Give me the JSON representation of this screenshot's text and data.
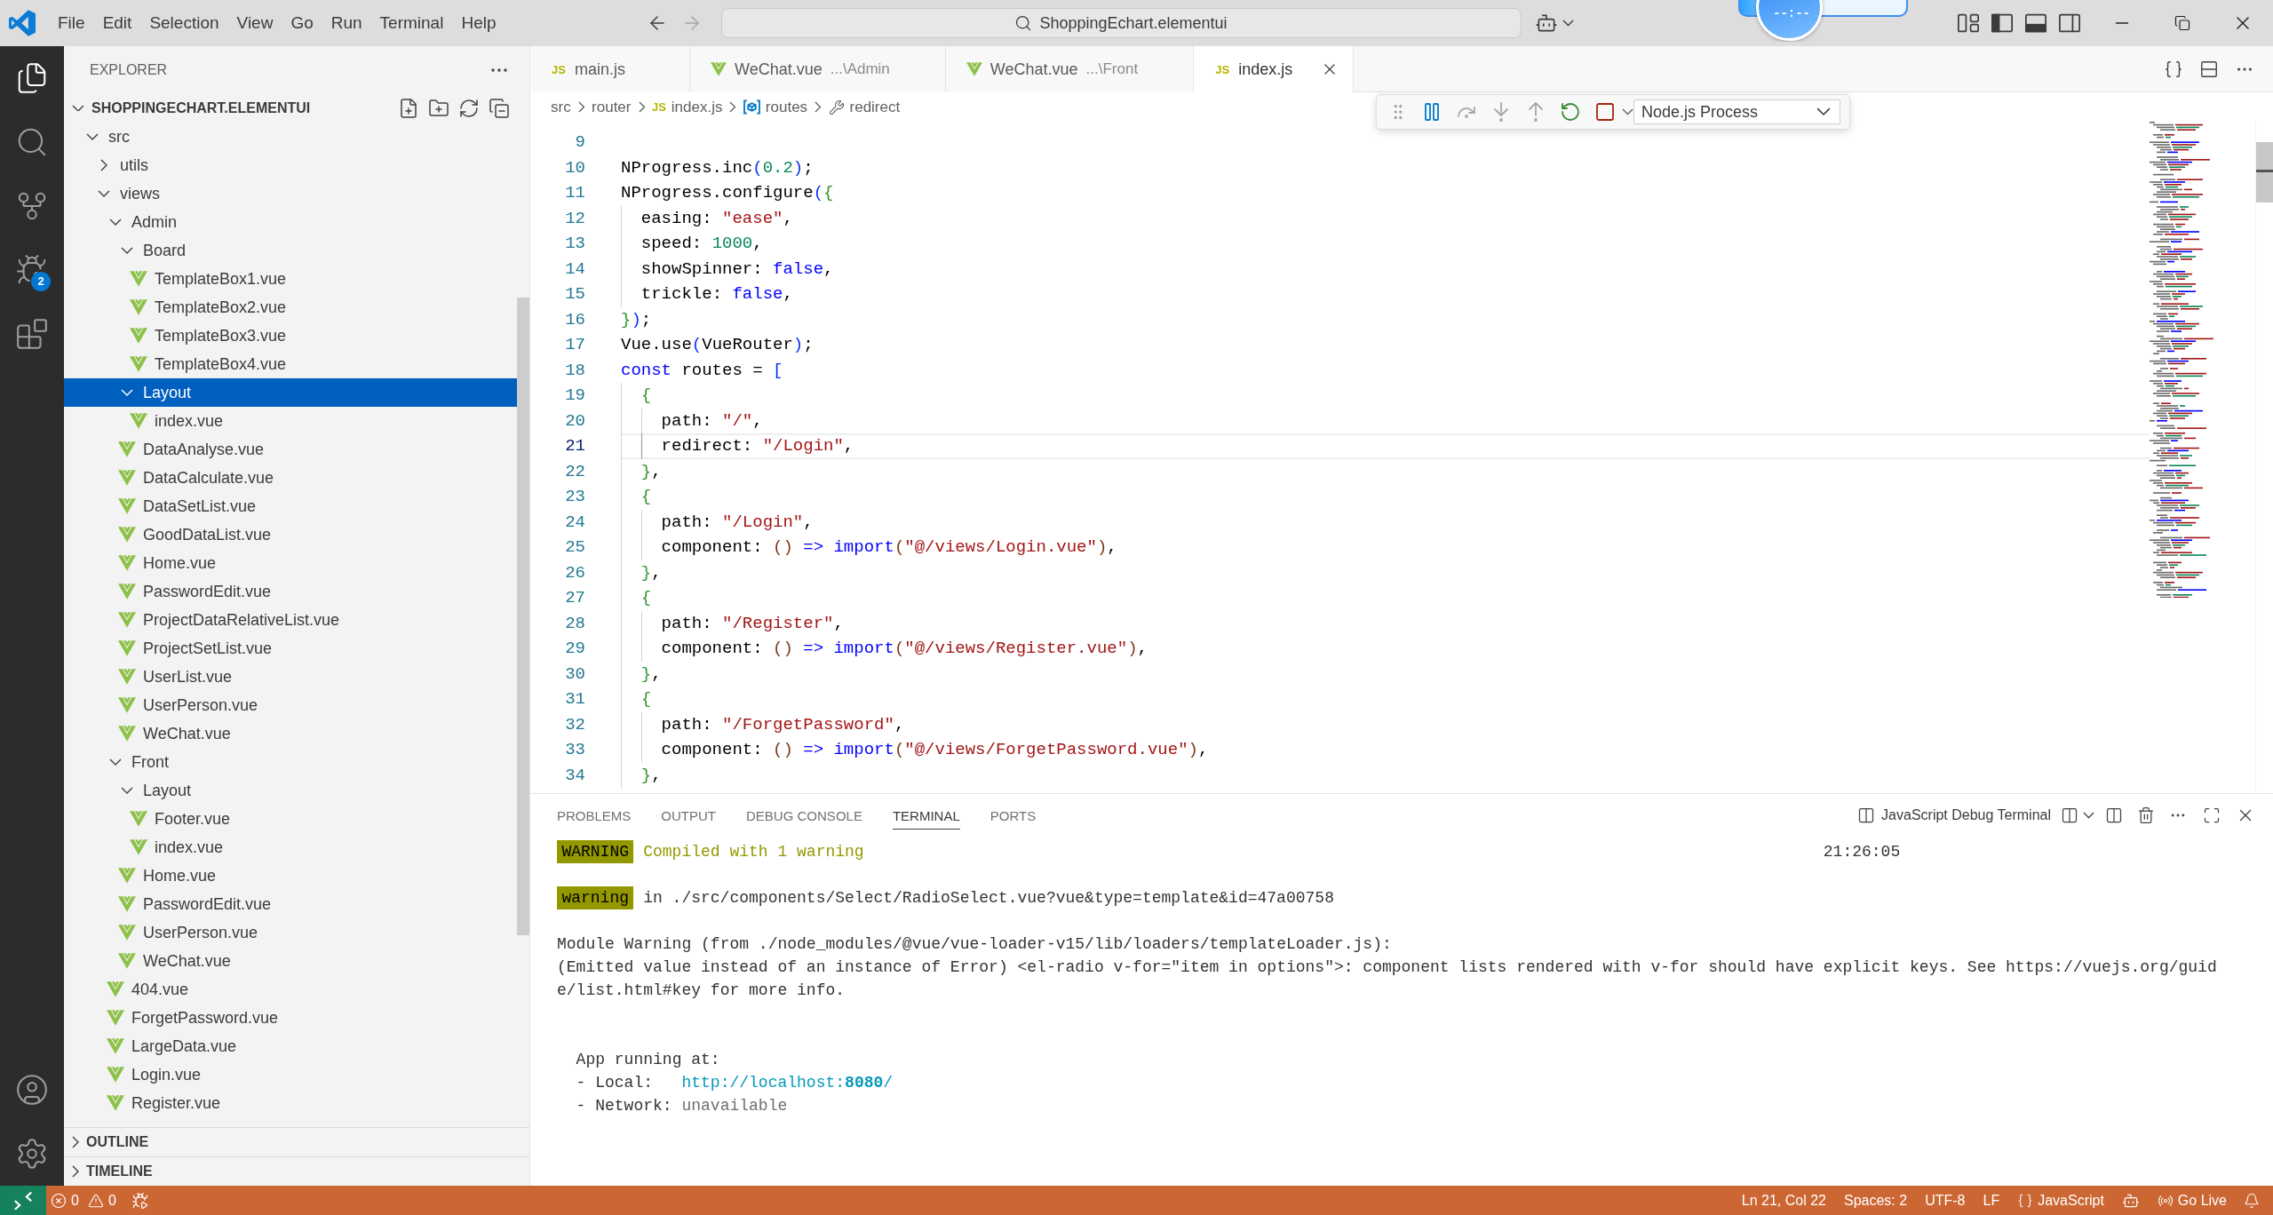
{
  "title_bar": {
    "menus": [
      "File",
      "Edit",
      "Selection",
      "View",
      "Go",
      "Run",
      "Terminal",
      "Help"
    ],
    "search": {
      "value": "ShoppingEchart.elementui"
    },
    "timer": {
      "text": "--:--"
    },
    "layout_toggles": [
      {
        "kind": "customize"
      },
      {
        "kind": "primary-sidebar",
        "on": true
      },
      {
        "kind": "panel",
        "on": true
      },
      {
        "kind": "secondary-sidebar",
        "on": false
      }
    ]
  },
  "activity_bar": {
    "items": [
      {
        "kind": "explorer",
        "selected": true
      },
      {
        "kind": "search",
        "selected": false
      },
      {
        "kind": "source-control",
        "selected": false
      },
      {
        "kind": "run-debug",
        "selected": false,
        "badge": "2"
      },
      {
        "kind": "extensions",
        "selected": false
      }
    ],
    "bottom": [
      {
        "kind": "accounts"
      },
      {
        "kind": "settings"
      }
    ]
  },
  "explorer": {
    "title": "EXPLORER",
    "project": {
      "name": "SHOPPINGECHART.ELEMENTUI",
      "expanded": true
    },
    "tree": [
      {
        "name": "src",
        "kind": "folder",
        "expanded": true,
        "selected": false,
        "children": [
          {
            "name": "utils",
            "kind": "folder",
            "expanded": false,
            "selected": false
          },
          {
            "name": "views",
            "kind": "folder",
            "expanded": true,
            "selected": false,
            "children": [
              {
                "name": "Admin",
                "kind": "folder",
                "expanded": true,
                "selected": false,
                "children": [
                  {
                    "name": "Board",
                    "kind": "folder",
                    "expanded": true,
                    "selected": false,
                    "children": [
                      {
                        "name": "TemplateBox1.vue",
                        "kind": "file",
                        "selected": false
                      },
                      {
                        "name": "TemplateBox2.vue",
                        "kind": "file",
                        "selected": false
                      },
                      {
                        "name": "TemplateBox3.vue",
                        "kind": "file",
                        "selected": false
                      },
                      {
                        "name": "TemplateBox4.vue",
                        "kind": "file",
                        "selected": false
                      }
                    ]
                  },
                  {
                    "name": "Layout",
                    "kind": "folder",
                    "expanded": true,
                    "selected": true,
                    "children": [
                      {
                        "name": "index.vue",
                        "kind": "file",
                        "selected": false
                      }
                    ]
                  },
                  {
                    "name": "DataAnalyse.vue",
                    "kind": "file",
                    "selected": false
                  },
                  {
                    "name": "DataCalculate.vue",
                    "kind": "file",
                    "selected": false
                  },
                  {
                    "name": "DataSetList.vue",
                    "kind": "file",
                    "selected": false
                  },
                  {
                    "name": "GoodDataList.vue",
                    "kind": "file",
                    "selected": false
                  },
                  {
                    "name": "Home.vue",
                    "kind": "file",
                    "selected": false
                  },
                  {
                    "name": "PasswordEdit.vue",
                    "kind": "file",
                    "selected": false
                  },
                  {
                    "name": "ProjectDataRelativeList.vue",
                    "kind": "file",
                    "selected": false
                  },
                  {
                    "name": "ProjectSetList.vue",
                    "kind": "file",
                    "selected": false
                  },
                  {
                    "name": "UserList.vue",
                    "kind": "file",
                    "selected": false
                  },
                  {
                    "name": "UserPerson.vue",
                    "kind": "file",
                    "selected": false
                  },
                  {
                    "name": "WeChat.vue",
                    "kind": "file",
                    "selected": false
                  }
                ]
              },
              {
                "name": "Front",
                "kind": "folder",
                "expanded": true,
                "selected": false,
                "children": [
                  {
                    "name": "Layout",
                    "kind": "folder",
                    "expanded": true,
                    "selected": false,
                    "children": [
                      {
                        "name": "Footer.vue",
                        "kind": "file",
                        "selected": false
                      },
                      {
                        "name": "index.vue",
                        "kind": "file",
                        "selected": false
                      }
                    ]
                  },
                  {
                    "name": "Home.vue",
                    "kind": "file",
                    "selected": false
                  },
                  {
                    "name": "PasswordEdit.vue",
                    "kind": "file",
                    "selected": false
                  },
                  {
                    "name": "UserPerson.vue",
                    "kind": "file",
                    "selected": false
                  },
                  {
                    "name": "WeChat.vue",
                    "kind": "file",
                    "selected": false
                  }
                ]
              },
              {
                "name": "404.vue",
                "kind": "file",
                "selected": false
              },
              {
                "name": "ForgetPassword.vue",
                "kind": "file",
                "selected": false
              },
              {
                "name": "LargeData.vue",
                "kind": "file",
                "selected": false
              },
              {
                "name": "Login.vue",
                "kind": "file",
                "selected": false
              },
              {
                "name": "Register.vue",
                "kind": "file",
                "selected": false
              }
            ]
          }
        ]
      }
    ],
    "sections": [
      {
        "title": "OUTLINE",
        "expanded": false
      },
      {
        "title": "TIMELINE",
        "expanded": false
      }
    ]
  },
  "tabs": [
    {
      "label": "main.js",
      "kind": "js",
      "icon_label": "JS",
      "selected": false
    },
    {
      "label": "WeChat.vue",
      "description": "...\\Admin",
      "kind": "vue",
      "selected": false
    },
    {
      "label": "WeChat.vue",
      "description": "...\\Front",
      "kind": "vue",
      "selected": false
    },
    {
      "label": "index.js",
      "kind": "js",
      "icon_label": "JS",
      "selected": true
    }
  ],
  "breadcrumb": [
    {
      "label": "src",
      "kind": "folder"
    },
    {
      "label": "router",
      "kind": "folder"
    },
    {
      "label": "index.js",
      "kind": "js",
      "icon_label": "JS"
    },
    {
      "label": "routes",
      "kind": "variable"
    },
    {
      "label": "redirect",
      "kind": "property"
    }
  ],
  "debug_toolbar": {
    "buttons": [
      {
        "kind": "pause",
        "disabled": false
      },
      {
        "kind": "step-over",
        "disabled": true
      },
      {
        "kind": "step-into",
        "disabled": true
      },
      {
        "kind": "step-out",
        "disabled": true
      },
      {
        "kind": "restart",
        "disabled": false
      },
      {
        "kind": "stop",
        "disabled": false
      }
    ],
    "target": {
      "value": "Node.js Process"
    }
  },
  "editor": {
    "lines": [
      {
        "number": "9",
        "current": false
      },
      {
        "number": "10",
        "current": false,
        "tokens": [
          {
            "kind": "plain",
            "text": "NProgress.inc"
          },
          {
            "kind": "bracket1",
            "text": "("
          },
          {
            "kind": "number",
            "text": "0.2"
          },
          {
            "kind": "bracket1",
            "text": ")"
          },
          {
            "kind": "plain",
            "text": ";"
          }
        ]
      },
      {
        "number": "11",
        "current": false,
        "tokens": [
          {
            "kind": "plain",
            "text": "NProgress.configure"
          },
          {
            "kind": "bracket1",
            "text": "("
          },
          {
            "kind": "bracket2",
            "text": "{"
          }
        ]
      },
      {
        "number": "12",
        "current": false,
        "tokens": [
          {
            "kind": "plain",
            "text": "  easing: "
          },
          {
            "kind": "string",
            "text": "\"ease\""
          },
          {
            "kind": "plain",
            "text": ","
          }
        ]
      },
      {
        "number": "13",
        "current": false,
        "tokens": [
          {
            "kind": "plain",
            "text": "  speed: "
          },
          {
            "kind": "number",
            "text": "1000"
          },
          {
            "kind": "plain",
            "text": ","
          }
        ]
      },
      {
        "number": "14",
        "current": false,
        "tokens": [
          {
            "kind": "plain",
            "text": "  showSpinner: "
          },
          {
            "kind": "keyword",
            "text": "false"
          },
          {
            "kind": "plain",
            "text": ","
          }
        ]
      },
      {
        "number": "15",
        "current": false,
        "tokens": [
          {
            "kind": "plain",
            "text": "  trickle: "
          },
          {
            "kind": "keyword",
            "text": "false"
          },
          {
            "kind": "plain",
            "text": ","
          }
        ]
      },
      {
        "number": "16",
        "current": false,
        "tokens": [
          {
            "kind": "bracket2",
            "text": "}"
          },
          {
            "kind": "bracket1",
            "text": ")"
          },
          {
            "kind": "plain",
            "text": ";"
          }
        ]
      },
      {
        "number": "17",
        "current": false,
        "tokens": [
          {
            "kind": "plain",
            "text": "Vue.use"
          },
          {
            "kind": "bracket1",
            "text": "("
          },
          {
            "kind": "plain",
            "text": "VueRouter"
          },
          {
            "kind": "bracket1",
            "text": ")"
          },
          {
            "kind": "plain",
            "text": ";"
          }
        ]
      },
      {
        "number": "18",
        "current": false,
        "tokens": [
          {
            "kind": "keyword",
            "text": "const"
          },
          {
            "kind": "plain",
            "text": " routes = "
          },
          {
            "kind": "bracket1",
            "text": "["
          }
        ]
      },
      {
        "number": "19",
        "current": false,
        "tokens": [
          {
            "kind": "bracket2",
            "text": "  {"
          }
        ]
      },
      {
        "number": "20",
        "current": false,
        "tokens": [
          {
            "kind": "plain",
            "text": "    path: "
          },
          {
            "kind": "string",
            "text": "\"/\""
          },
          {
            "kind": "plain",
            "text": ","
          }
        ]
      },
      {
        "number": "21",
        "current": true,
        "tokens": [
          {
            "kind": "plain",
            "text": "    redirect: "
          },
          {
            "kind": "string",
            "text": "\"/Login\""
          },
          {
            "kind": "plain",
            "text": ","
          }
        ]
      },
      {
        "number": "22",
        "current": false,
        "tokens": [
          {
            "kind": "bracket2",
            "text": "  }"
          },
          {
            "kind": "plain",
            "text": ","
          }
        ]
      },
      {
        "number": "23",
        "current": false,
        "tokens": [
          {
            "kind": "bracket2",
            "text": "  {"
          }
        ]
      },
      {
        "number": "24",
        "current": false,
        "tokens": [
          {
            "kind": "plain",
            "text": "    path: "
          },
          {
            "kind": "string",
            "text": "\"/Login\""
          },
          {
            "kind": "plain",
            "text": ","
          }
        ]
      },
      {
        "number": "25",
        "current": false,
        "tokens": [
          {
            "kind": "plain",
            "text": "    component: "
          },
          {
            "kind": "bracket3",
            "text": "()"
          },
          {
            "kind": "keyword",
            "text": " => import"
          },
          {
            "kind": "bracket3",
            "text": "("
          },
          {
            "kind": "string",
            "text": "\"@/views/Login.vue\""
          },
          {
            "kind": "bracket3",
            "text": ")"
          },
          {
            "kind": "plain",
            "text": ","
          }
        ]
      },
      {
        "number": "26",
        "current": false,
        "tokens": [
          {
            "kind": "bracket2",
            "text": "  }"
          },
          {
            "kind": "plain",
            "text": ","
          }
        ]
      },
      {
        "number": "27",
        "current": false,
        "tokens": [
          {
            "kind": "bracket2",
            "text": "  {"
          }
        ]
      },
      {
        "number": "28",
        "current": false,
        "tokens": [
          {
            "kind": "plain",
            "text": "    path: "
          },
          {
            "kind": "string",
            "text": "\"/Register\""
          },
          {
            "kind": "plain",
            "text": ","
          }
        ]
      },
      {
        "number": "29",
        "current": false,
        "tokens": [
          {
            "kind": "plain",
            "text": "    component: "
          },
          {
            "kind": "bracket3",
            "text": "()"
          },
          {
            "kind": "keyword",
            "text": " => import"
          },
          {
            "kind": "bracket3",
            "text": "("
          },
          {
            "kind": "string",
            "text": "\"@/views/Register.vue\""
          },
          {
            "kind": "bracket3",
            "text": ")"
          },
          {
            "kind": "plain",
            "text": ","
          }
        ]
      },
      {
        "number": "30",
        "current": false,
        "tokens": [
          {
            "kind": "bracket2",
            "text": "  }"
          },
          {
            "kind": "plain",
            "text": ","
          }
        ]
      },
      {
        "number": "31",
        "current": false,
        "tokens": [
          {
            "kind": "bracket2",
            "text": "  {"
          }
        ]
      },
      {
        "number": "32",
        "current": false,
        "tokens": [
          {
            "kind": "plain",
            "text": "    path: "
          },
          {
            "kind": "string",
            "text": "\"/ForgetPassword\""
          },
          {
            "kind": "plain",
            "text": ","
          }
        ]
      },
      {
        "number": "33",
        "current": false,
        "tokens": [
          {
            "kind": "plain",
            "text": "    component: "
          },
          {
            "kind": "bracket3",
            "text": "()"
          },
          {
            "kind": "keyword",
            "text": " => import"
          },
          {
            "kind": "bracket3",
            "text": "("
          },
          {
            "kind": "string",
            "text": "\"@/views/ForgetPassword.vue\""
          },
          {
            "kind": "bracket3",
            "text": ")"
          },
          {
            "kind": "plain",
            "text": ","
          }
        ]
      },
      {
        "number": "34",
        "current": false,
        "tokens": [
          {
            "kind": "bracket2",
            "text": "  }"
          },
          {
            "kind": "plain",
            "text": ","
          }
        ]
      }
    ]
  },
  "panel": {
    "tabs": [
      {
        "label": "PROBLEMS",
        "selected": false
      },
      {
        "label": "OUTPUT",
        "selected": false
      },
      {
        "label": "DEBUG CONSOLE",
        "selected": false
      },
      {
        "label": "TERMINAL",
        "selected": true
      },
      {
        "label": "PORTS",
        "selected": false
      }
    ],
    "terminal": {
      "name": "JavaScript Debug Terminal",
      "lines": [
        {
          "kind": "text",
          "segments": [
            {
              "kind": "badge",
              "text": "WARNING"
            },
            {
              "kind": "warn",
              "text": "Compiled with 1 warning"
            }
          ],
          "time": "21:26:05"
        },
        {
          "kind": "blank"
        },
        {
          "kind": "text",
          "segments": [
            {
              "kind": "badge",
              "text": "warning"
            },
            {
              "kind": "plain",
              "text": "in ./src/components/Select/RadioSelect.vue?vue&type=template&id=47a00758"
            }
          ]
        },
        {
          "kind": "blank"
        },
        {
          "kind": "text",
          "segments": [
            {
              "kind": "plain",
              "text": "Module Warning (from ./node_modules/@vue/vue-loader-v15/lib/loaders/templateLoader.js):"
            }
          ]
        },
        {
          "kind": "text",
          "segments": [
            {
              "kind": "plain",
              "text": "(Emitted value instead of an instance of Error) <el-radio v-for=\"item in options\">: component lists rendered with v-for should have explicit keys. See https://vuejs.org/guid"
            }
          ]
        },
        {
          "kind": "text",
          "segments": [
            {
              "kind": "plain",
              "text": "e/list.html#key for more info."
            }
          ]
        },
        {
          "kind": "blank"
        },
        {
          "kind": "blank"
        },
        {
          "kind": "text",
          "segments": [
            {
              "kind": "plain",
              "text": "  App running at:"
            }
          ]
        },
        {
          "kind": "text",
          "segments": [
            {
              "kind": "plain",
              "text": "  - Local:   "
            },
            {
              "kind": "link",
              "text": "http://localhost:**8080**/"
            }
          ]
        },
        {
          "kind": "text",
          "segments": [
            {
              "kind": "plain",
              "text": "  - Network: "
            },
            {
              "kind": "muted",
              "text": "unavailable"
            }
          ]
        }
      ]
    }
  },
  "status_bar": {
    "left": [
      {
        "kind": "remote"
      },
      {
        "kind": "errors",
        "label": "0"
      },
      {
        "kind": "warnings",
        "label": "0"
      },
      {
        "kind": "debug"
      }
    ],
    "right": [
      {
        "kind": "text",
        "label": "Ln 21, Col 22"
      },
      {
        "kind": "text",
        "label": "Spaces: 2"
      },
      {
        "kind": "text",
        "label": "UTF-8"
      },
      {
        "kind": "text",
        "label": "LF"
      },
      {
        "kind": "language",
        "label": "JavaScript"
      },
      {
        "kind": "copilot"
      },
      {
        "kind": "go-live",
        "label": "Go Live"
      },
      {
        "kind": "notifications"
      }
    ]
  }
}
